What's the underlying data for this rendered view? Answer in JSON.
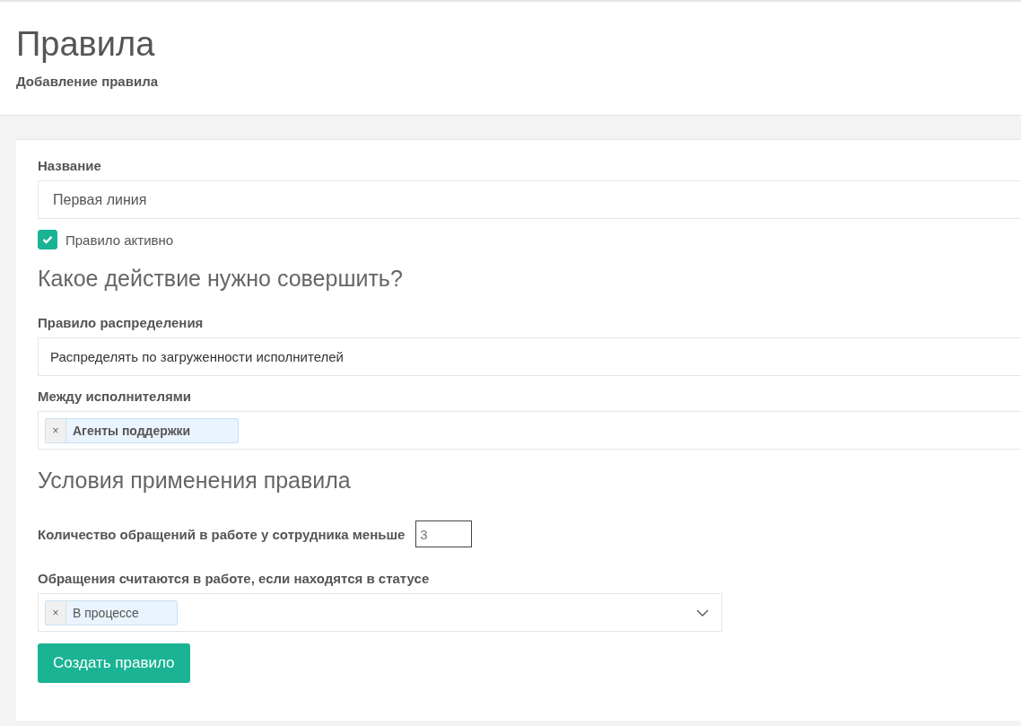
{
  "header": {
    "title": "Правила",
    "subtitle": "Добавление правила"
  },
  "name_field": {
    "label": "Название",
    "value": "Первая линия"
  },
  "active_checkbox": {
    "label": "Правило активно",
    "checked": true
  },
  "action_section": {
    "heading": "Какое действие нужно совершить?",
    "distribution_field": {
      "label": "Правило распределения",
      "value": "Распределять по загруженности исполнителей"
    },
    "assignees_field": {
      "label": "Между исполнителями",
      "tags": [
        {
          "label": "Агенты поддержки",
          "remove": "×"
        }
      ]
    }
  },
  "conditions_section": {
    "heading": "Условия применения правила",
    "count_field": {
      "label": "Количество обращений в работе у сотрудника меньше",
      "value": "3"
    },
    "status_field": {
      "label": "Обращения считаются в работе, если находятся в статусе",
      "tags": [
        {
          "label": "В процессе",
          "remove": "×"
        }
      ]
    }
  },
  "submit_button": {
    "label": "Создать правило"
  }
}
